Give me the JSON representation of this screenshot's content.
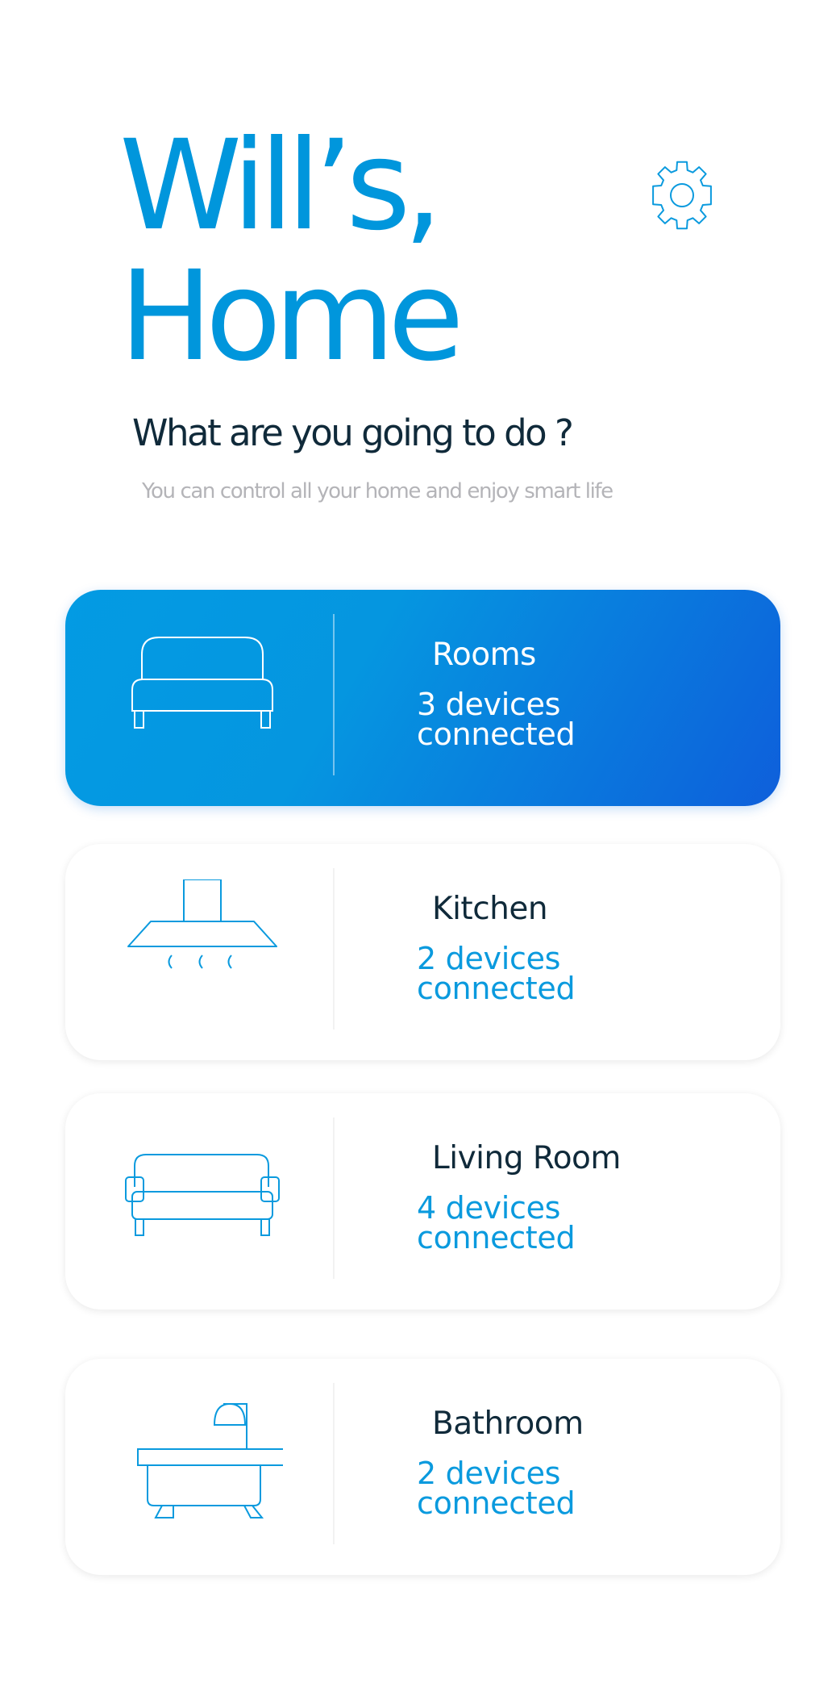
{
  "header": {
    "title_line1": "Will’s,",
    "title_line2": "Home",
    "settings_icon": "gear-icon",
    "question": "What are you going to do ?",
    "subtitle": "You can control all your home and enjoy smart life"
  },
  "colors": {
    "accent": "#0096dc",
    "gradient_start": "#039be3",
    "gradient_end": "#0e5fdb",
    "heading_dark": "#102a3a",
    "muted_gray": "#b4b4b8"
  },
  "rooms": [
    {
      "name": "Rooms",
      "devices": "3 devices connected",
      "icon": "bed-icon",
      "active": true
    },
    {
      "name": "Kitchen",
      "devices": "2 devices connected",
      "icon": "range-hood-icon",
      "active": false
    },
    {
      "name": "Living Room",
      "devices": "4 devices connected",
      "icon": "sofa-icon",
      "active": false
    },
    {
      "name": "Bathroom",
      "devices": "2 devices connected",
      "icon": "bathtub-icon",
      "active": false
    }
  ]
}
